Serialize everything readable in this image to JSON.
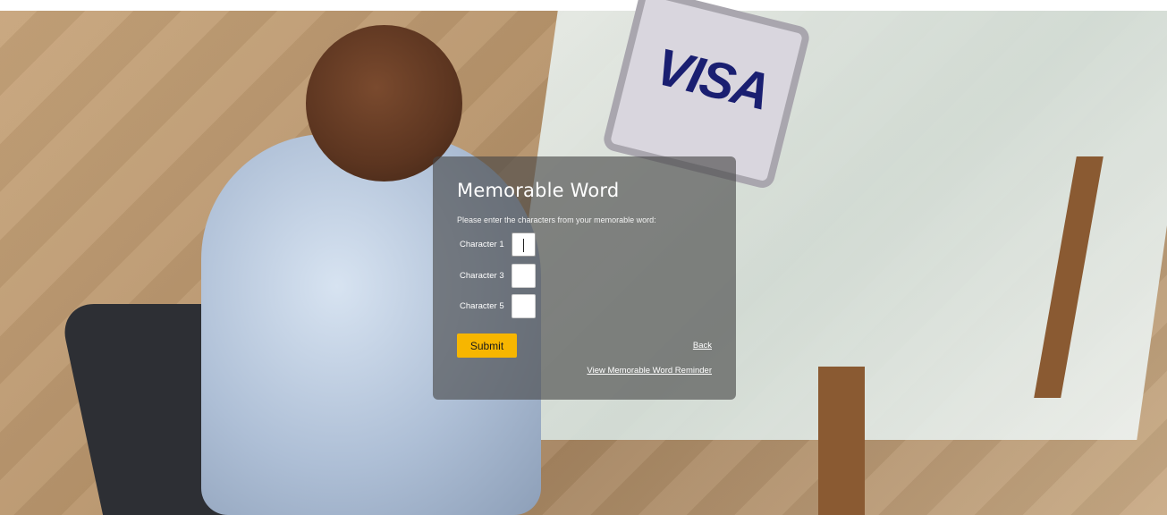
{
  "background": {
    "brand_logo_text": "VISA",
    "accent_color": "#f7b600"
  },
  "dialog": {
    "title": "Memorable Word",
    "instruction": "Please enter the characters from your memorable word:",
    "fields": [
      {
        "label": "Character 1",
        "value": ""
      },
      {
        "label": "Character 3",
        "value": ""
      },
      {
        "label": "Character 5",
        "value": ""
      }
    ],
    "submit_label": "Submit",
    "back_label": "Back",
    "reminder_label": "View Memorable Word Reminder"
  }
}
